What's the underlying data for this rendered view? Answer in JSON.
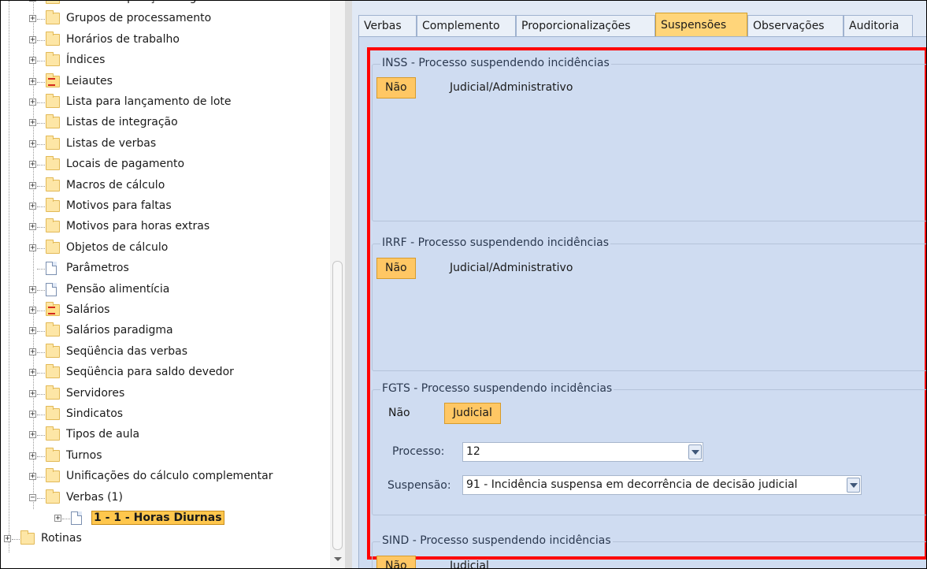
{
  "tree": {
    "items": [
      {
        "label": "Grau de exposição a agentes nocivos",
        "icon": "folder-icon"
      },
      {
        "label": "Grupos de processamento",
        "icon": "folder-icon"
      },
      {
        "label": "Horários de trabalho",
        "icon": "folder-icon"
      },
      {
        "label": "Índices",
        "icon": "folder-icon"
      },
      {
        "label": "Leiautes",
        "icon": "layout-folder-icon"
      },
      {
        "label": "Lista para lançamento de lote",
        "icon": "folder-icon"
      },
      {
        "label": "Listas de integração",
        "icon": "folder-icon"
      },
      {
        "label": "Listas de verbas",
        "icon": "folder-icon"
      },
      {
        "label": "Locais de pagamento",
        "icon": "folder-icon"
      },
      {
        "label": "Macros de cálculo",
        "icon": "folder-icon"
      },
      {
        "label": "Motivos para faltas",
        "icon": "folder-icon"
      },
      {
        "label": "Motivos para horas extras",
        "icon": "folder-icon"
      },
      {
        "label": "Objetos de cálculo",
        "icon": "folder-icon"
      },
      {
        "label": "Parâmetros",
        "icon": "document-icon"
      },
      {
        "label": "Pensão alimentícia",
        "icon": "document-icon"
      },
      {
        "label": "Salários",
        "icon": "layout-folder-icon"
      },
      {
        "label": "Salários paradigma",
        "icon": "folder-icon"
      },
      {
        "label": "Seqüência das verbas",
        "icon": "folder-icon"
      },
      {
        "label": "Seqüência para saldo devedor",
        "icon": "folder-icon"
      },
      {
        "label": "Servidores",
        "icon": "folder-icon"
      },
      {
        "label": "Sindicatos",
        "icon": "folder-icon"
      },
      {
        "label": "Tipos de aula",
        "icon": "folder-icon"
      },
      {
        "label": "Turnos",
        "icon": "folder-icon"
      },
      {
        "label": "Unificações do cálculo complementar",
        "icon": "folder-icon"
      },
      {
        "label": "Verbas (1)",
        "icon": "folder-icon"
      }
    ],
    "selected_child": {
      "label": "1 - 1 - Horas Diurnas",
      "icon": "document-icon"
    },
    "root_next": {
      "label": "Rotinas",
      "icon": "folder-icon"
    }
  },
  "tabs": [
    "Verbas",
    "Complemento",
    "Proporcionalizações",
    "Suspensões",
    "Observações",
    "Auditoria"
  ],
  "active_tab": "Suspensões",
  "groups": {
    "inss": {
      "title": "INSS - Processo suspendendo incidências",
      "opt1": "Não",
      "opt2": "Judicial/Administrativo",
      "selected": "Não"
    },
    "irrf": {
      "title": "IRRF - Processo suspendendo incidências",
      "opt1": "Não",
      "opt2": "Judicial/Administrativo",
      "selected": "Não"
    },
    "fgts": {
      "title": "FGTS - Processo suspendendo incidências",
      "opt1": "Não",
      "opt2": "Judicial",
      "selected": "Judicial",
      "processo_label": "Processo:",
      "processo_value": "12",
      "suspensao_label": "Suspensão:",
      "suspensao_value": "91 - Incidência suspensa em decorrência de decisão judicial"
    },
    "sind": {
      "title": "SIND - Processo suspendendo incidências",
      "opt1": "Não",
      "opt2": "Judicial",
      "selected": "Não"
    }
  },
  "colors": {
    "highlight": "#ff0000",
    "selected": "#ffc764",
    "panel": "#cfdcf1"
  }
}
